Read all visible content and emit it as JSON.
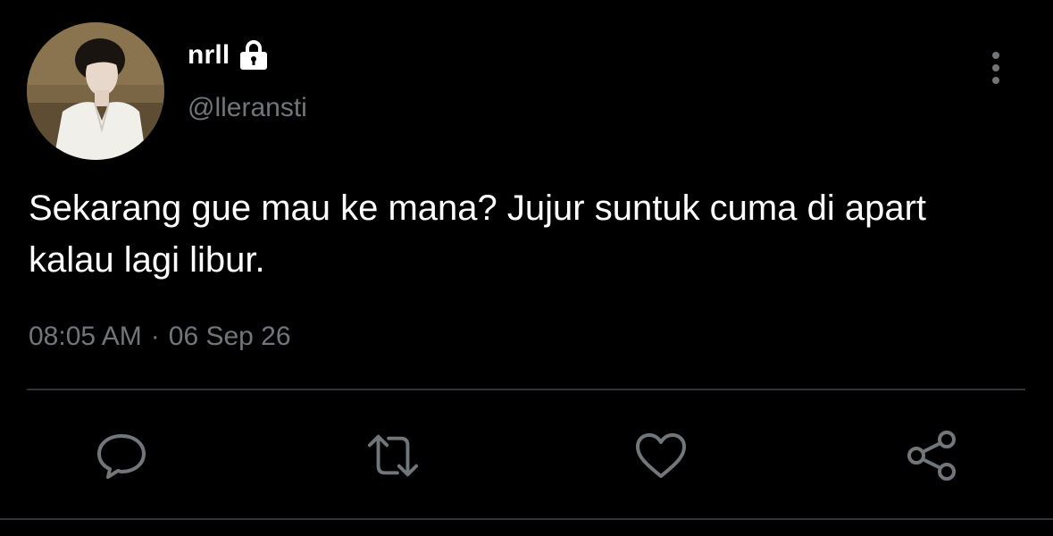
{
  "user": {
    "display_name": "nrll",
    "handle": "@lleransti",
    "locked": true,
    "avatar": "profile-photo"
  },
  "tweet": {
    "text": "Sekarang gue mau ke mana? Jujur suntuk cuma di apart kalau lagi libur.",
    "time": "08:05 AM",
    "separator": "·",
    "date": "06 Sep 26"
  },
  "actions": [
    {
      "name": "reply",
      "icon": "comment-icon"
    },
    {
      "name": "retweet",
      "icon": "retweet-icon"
    },
    {
      "name": "like",
      "icon": "heart-icon"
    },
    {
      "name": "share",
      "icon": "share-icon"
    }
  ],
  "colors": {
    "background": "#000000",
    "text_primary": "#ffffff",
    "text_secondary": "#71767b",
    "divider": "#2f3336"
  }
}
